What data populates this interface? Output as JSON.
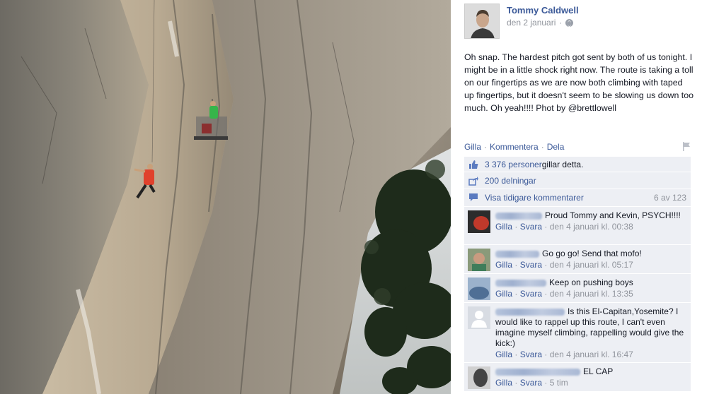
{
  "photo": {
    "description_icon": "climbing-photo",
    "rock_color": "#a89d8b",
    "tree_color": "#1d2a1a"
  },
  "post": {
    "author": "Tommy Caldwell",
    "date": "den 2 januari",
    "date_separator": "·",
    "privacy_icon": "globe-icon",
    "text": "Oh snap. The hardest pitch got sent by both of us tonight. I might be in a little shock right now. The route is taking a toll on our fingertips as we are now both climbing with taped up fingertips, but it doesn't seem to be slowing us down too much. Oh yeah!!!! Phot by @brettlowell",
    "actions": {
      "like": "Gilla",
      "comment": "Kommentera",
      "share": "Dela",
      "sep": "·"
    },
    "likes": {
      "count_link": "3 376 personer",
      "suffix": " gillar detta."
    },
    "shares": "200 delningar",
    "view_previous": "Visa tidigare kommentarer",
    "comment_count": "6 av 123",
    "comments": [
      {
        "text": "Proud Tommy and Kevin, PSYCH!!!!",
        "like": "Gilla",
        "reply": "Svara",
        "time": "den 4 januari kl. 00:38",
        "avatar_color": "#c0392b"
      },
      {
        "text": "Go go go! Send that mofo!",
        "like": "Gilla",
        "reply": "Svara",
        "time": "den 4 januari kl. 05:17",
        "avatar_color": "#7a8a6a"
      },
      {
        "text": "Keep on pushing boys",
        "like": "Gilla",
        "reply": "Svara",
        "time": "den 4 januari kl. 13:35",
        "avatar_color": "#6b8fb3"
      },
      {
        "text": "Is this El-Capitan,Yosemite? I would like to rappel up this route, I can't even imagine myself climbing, rappelling would give the kick:)",
        "like": "Gilla",
        "reply": "Svara",
        "time": "den 4 januari kl. 16:47",
        "avatar_color": "#d8dce3"
      },
      {
        "text": "EL CAP",
        "like": "Gilla",
        "reply": "Svara",
        "time": "5 tim",
        "avatar_color": "#555555"
      }
    ],
    "accent": "#3b5998",
    "panel_bg": "#edeff4"
  }
}
